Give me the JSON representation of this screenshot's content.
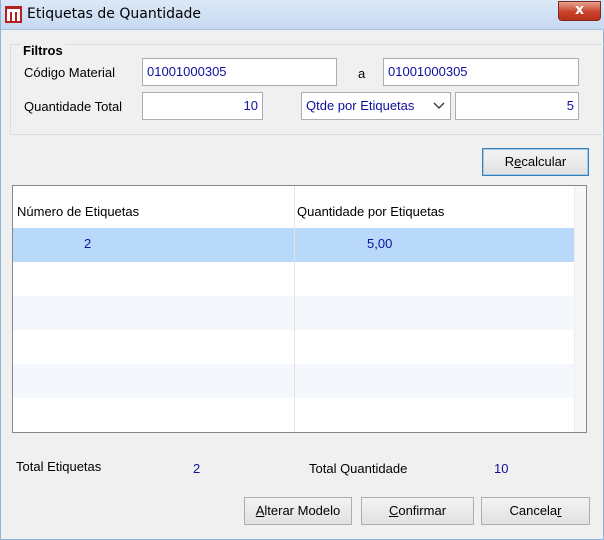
{
  "window": {
    "title": "Etiquetas de Quantidade",
    "close_label": "x"
  },
  "filters": {
    "group_label": "Filtros",
    "codigo_label": "Código Material",
    "codigo_from": "01001000305",
    "range_sep": "a",
    "codigo_to": "01001000305",
    "quantidade_label": "Quantidade Total",
    "quantidade_value": "10",
    "mode_selected": "Qtde por Etiquetas",
    "mode_value": "5"
  },
  "actions": {
    "recalcular_pre": "R",
    "recalcular_u": "e",
    "recalcular_post": "calcular",
    "alterar_u": "A",
    "alterar_post": "lterar Modelo",
    "confirmar_u": "C",
    "confirmar_post": "onfirmar",
    "cancelar_pre": "Cancela",
    "cancelar_u": "r"
  },
  "grid": {
    "columns": [
      "Número de Etiquetas",
      "Quantidade por Etiquetas"
    ],
    "rows": [
      {
        "numero": "2",
        "quantidade": "5,00"
      }
    ]
  },
  "totals": {
    "etiquetas_label": "Total Etiquetas",
    "etiquetas_value": "2",
    "quantidade_label": "Total Quantidade",
    "quantidade_value": "10"
  },
  "colors": {
    "selected_row": "#b9d9fb",
    "alt_row": "#f4f8fc",
    "value_text": "#0f0f9f",
    "app_icon": "#b52020"
  }
}
